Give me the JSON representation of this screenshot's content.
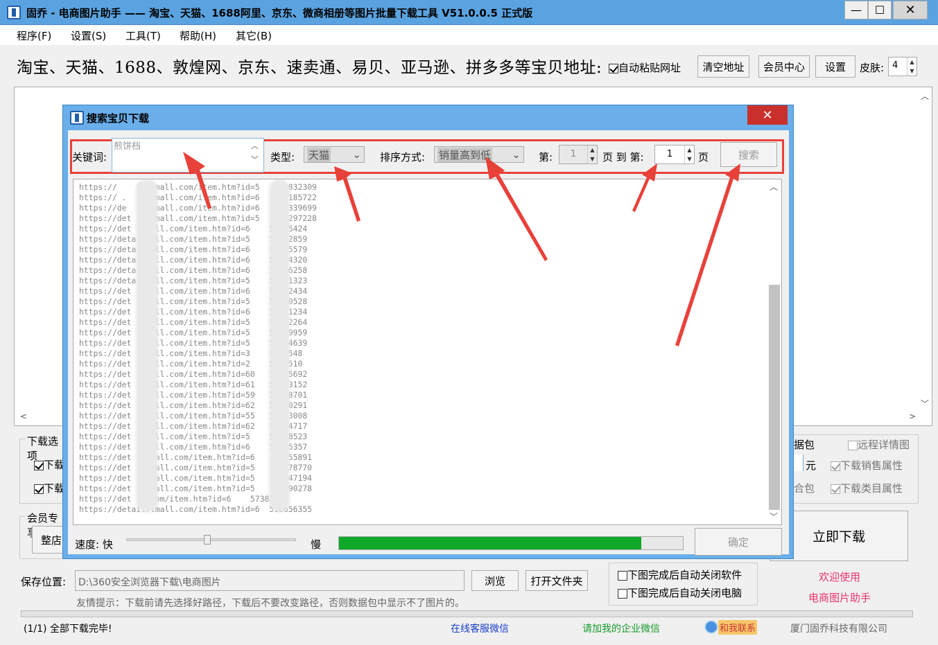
{
  "window": {
    "title": "固乔 - 电商图片助手 —— 淘宝、天猫、1688阿里、京东、微商相册等图片批量下载工具 V51.0.0.5 正式版",
    "minimize": "—",
    "maximize": "☐",
    "close": "✕"
  },
  "menu": [
    "程序(F)",
    "设置(S)",
    "工具(T)",
    "帮助(H)",
    "其它(B)"
  ],
  "header": {
    "headline": "淘宝、天猫、1688、敦煌网、京东、速卖通、易贝、亚马逊、拼多多等宝贝地址:",
    "auto_paste_label": "自动粘贴网址",
    "clear_button": "清空地址",
    "member_button": "会员中心",
    "settings_button": "设置",
    "skin_label": "皮肤:",
    "skin_value": "4"
  },
  "options": {
    "download_options_label": "下载选项",
    "member_label": "会员专享",
    "whole_shop_button": "整店",
    "download_partial_1": "下载",
    "download_partial_2": "下载",
    "data_pack_partial": "据包",
    "yuan": "元",
    "merge_partial": "合包",
    "remote_detail": "远程详情图",
    "sales_attr": "下载销售属性",
    "category_attr": "下载类目属性",
    "download_now": "立即下载",
    "auto_close_software": "下图完成后自动关闭软件",
    "auto_close_pc": "下图完成后自动关闭电脑",
    "welcome": "欢迎使用",
    "app_name": "电商图片助手"
  },
  "save": {
    "label": "保存位置:",
    "path": "D:\\360安全浏览器下载\\电商图片",
    "browse_button": "浏览",
    "open_folder_button": "打开文件夹",
    "tip": "友情提示：下载前请先选择好路径，下载后不要改变路径，否则数据包中显示不了图片的。"
  },
  "status": {
    "text": "(1/1) 全部下载完毕!",
    "service_wechat": "在线客服微信",
    "enterprise_wechat": "请加我的企业微信",
    "contact": "和我联系",
    "company": "厦门固乔科技有限公司"
  },
  "dialog": {
    "title": "搜索宝贝下载",
    "close": "✕",
    "keyword_label": "关键词:",
    "keyword_value": "煎饼档",
    "type_label": "类型:",
    "type_value": "天猫",
    "sort_label": "排序方式:",
    "sort_value": "销量高到低",
    "page_prefix": "第:",
    "page_from": "1",
    "page_to_text": "页 到 第:",
    "page_to": "1",
    "page_suffix": "页",
    "search_button": "搜索",
    "results": [
      "https://    il.tmall.com/item.htm?id=5    33832309",
      "https:// .   l.tmall.com/item.htm?id=6    55185722",
      "https://de    .tmall.com/item.htm?id=6    36339699",
      "https://det   .tmall.com/item.htm?id=5    54297228",
      "https://det   mall.com/item.htm?id=6    57505424",
      "https://deta  mall.com/item.htm?id=5    55602859",
      "https://deta  mall.com/item.htm?id=6    58585579",
      "https://deta  mall.com/item.htm?id=6    57754320",
      "https://deta  mall.com/item.htm?id=6    59296258",
      "https://deta  mall.com/item.htm?id=5    59021323",
      "https://det   mall.com/item.htm?id=6    52042434",
      "https://det   mall.com/item.htm?id=5    53580528",
      "https://det   mall.com/item.htm?id=6    56271234",
      "https://det   mall.com/item.htm?id=5    51102264",
      "https://det   mall.com/item.htm?id=5    58209959",
      "https://det   mall.com/item.htm?id=5    54424639",
      "https://det   mall.com/item.htm?id=3    5455548",
      "https://det   mall.com/item.htm?id=2    5900510",
      "https://det   mall.com/item.htm?id=60   53585692",
      "https://det   mall.com/item.htm?id=61   53663152",
      "https://det   mall.com/item.htm?id=59   52958701",
      "https://det   mall.com/item.htm?id=62   53330291",
      "https://det   mall.com/item.htm?id=55   55213008",
      "https://det   mall.com/item.htm?id=62   54834717",
      "https://det   mall.com/item.htm?id=5    54108523",
      "https://det   mall.com/item.htm?id=6    59755357",
      "https://det   tmall.com/item.htm?id=6    56355891",
      "https://det   tmall.com/item.htm?id=5    58878770",
      "https://det   tmall.com/item.htm?id=5    53047194",
      "https://det   tmall.com/item.htm?id=5    53590278",
      "https://det   .com/item.htm?id=6    57387869",
      "https://detail.tmall.com/item.htm?id=6  516656355"
    ],
    "speed_label": "速度: 快",
    "slow_label": "慢",
    "progress": 0.88,
    "ok_button": "确定"
  },
  "colors": {
    "titlebar": "#5aa3e0",
    "dialog_frame": "#6aaeea",
    "highlight": "#e8413a",
    "progress": "#0fa828",
    "pink": "#e8336b",
    "link_blue": "#1a3ec9",
    "link_green": "#179a2c"
  }
}
